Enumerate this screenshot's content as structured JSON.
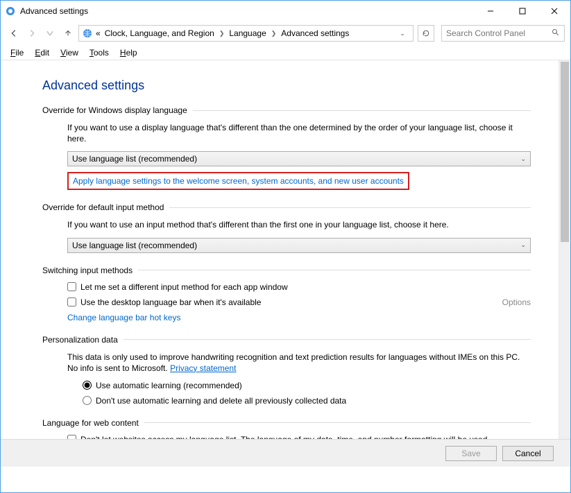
{
  "titlebar": {
    "title": "Advanced settings"
  },
  "breadcrumb": {
    "prefix": "«",
    "items": [
      "Clock, Language, and Region",
      "Language",
      "Advanced settings"
    ]
  },
  "search": {
    "placeholder": "Search Control Panel"
  },
  "menubar": {
    "file": "File",
    "edit": "Edit",
    "view": "View",
    "tools": "Tools",
    "help": "Help"
  },
  "page": {
    "title": "Advanced settings"
  },
  "section1": {
    "head": "Override for Windows display language",
    "desc": "If you want to use a display language that's different than the one determined by the order of your language list, choose it here.",
    "dropdown": "Use language list (recommended)",
    "link": "Apply language settings to the welcome screen, system accounts, and new user accounts"
  },
  "section2": {
    "head": "Override for default input method",
    "desc": "If you want to use an input method that's different than the first one in your language list, choose it here.",
    "dropdown": "Use language list (recommended)"
  },
  "section3": {
    "head": "Switching input methods",
    "check1": "Let me set a different input method for each app window",
    "check2": "Use the desktop language bar when it's available",
    "options": "Options",
    "link": "Change language bar hot keys"
  },
  "section4": {
    "head": "Personalization data",
    "desc": "This data is only used to improve handwriting recognition and text prediction results for languages without IMEs on this PC. No info is sent to Microsoft. ",
    "privacy": "Privacy statement",
    "radio1": "Use automatic learning (recommended)",
    "radio2": "Don't use automatic learning and delete all previously collected data"
  },
  "section5": {
    "head": "Language for web content",
    "check1": "Don't let websites access my language list. The language of my date, time, and number formatting will be used"
  },
  "footer": {
    "save": "Save",
    "cancel": "Cancel"
  }
}
